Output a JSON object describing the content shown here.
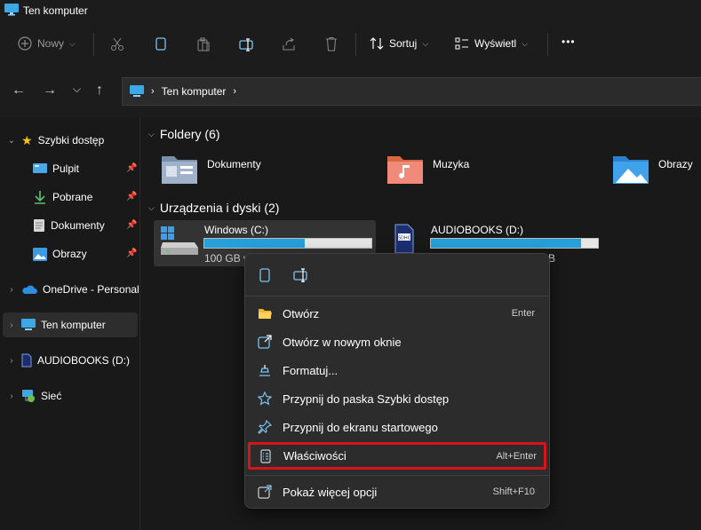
{
  "window": {
    "title": "Ten komputer"
  },
  "toolbar": {
    "new_label": "Nowy",
    "sort_label": "Sortuj",
    "view_label": "Wyświetl",
    "more_label": "•••"
  },
  "address": {
    "location": "Ten komputer"
  },
  "sidebar": {
    "quick_access": "Szybki dostęp",
    "items": [
      {
        "label": "Pulpit"
      },
      {
        "label": "Pobrane"
      },
      {
        "label": "Dokumenty"
      },
      {
        "label": "Obrazy"
      }
    ],
    "onedrive": "OneDrive - Personal",
    "this_pc": "Ten komputer",
    "audiobooks": "AUDIOBOOKS (D:)",
    "network": "Sieć"
  },
  "content": {
    "folders_header": "Foldery (6)",
    "folders": [
      {
        "label": "Dokumenty"
      },
      {
        "label": "Muzyka"
      },
      {
        "label": "Obrazy"
      }
    ],
    "drives_header": "Urządzenia i dyski (2)",
    "drives": [
      {
        "name": "Windows (C:)",
        "info": "100 GB w",
        "used_fraction": 0.6
      },
      {
        "name": "AUDIOBOOKS (D:)",
        "info": "B",
        "used_fraction": 0.9
      }
    ]
  },
  "context_menu": {
    "items": [
      {
        "label": "Otwórz",
        "shortcut": "Enter",
        "icon": "folder-open-icon"
      },
      {
        "label": "Otwórz w nowym oknie",
        "shortcut": "",
        "icon": "open-new-window-icon"
      },
      {
        "label": "Formatuj...",
        "shortcut": "",
        "icon": "format-icon"
      },
      {
        "label": "Przypnij do paska Szybki dostęp",
        "shortcut": "",
        "icon": "star-icon"
      },
      {
        "label": "Przypnij do ekranu startowego",
        "shortcut": "",
        "icon": "pin-icon"
      },
      {
        "label": "Właściwości",
        "shortcut": "Alt+Enter",
        "icon": "properties-icon"
      },
      {
        "label": "Pokaż więcej opcji",
        "shortcut": "Shift+F10",
        "icon": "more-options-icon"
      }
    ]
  },
  "colors": {
    "accent": "#26a0da",
    "highlight_border": "#d8141b",
    "background": "#191919"
  }
}
